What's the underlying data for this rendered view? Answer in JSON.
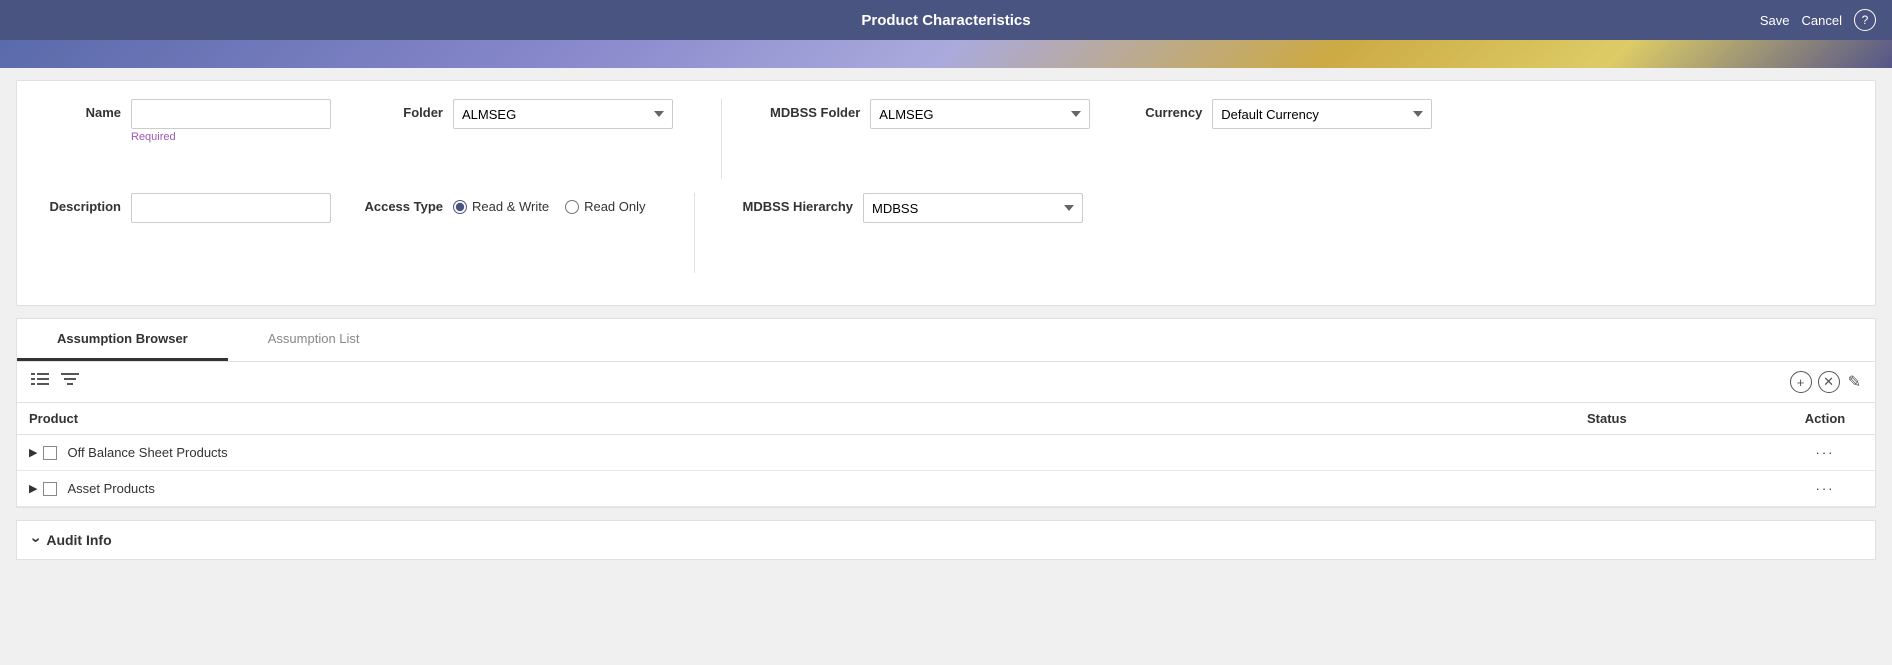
{
  "header": {
    "title": "Product Characteristics",
    "save_label": "Save",
    "cancel_label": "Cancel",
    "help_icon": "?"
  },
  "form": {
    "name_label": "Name",
    "name_placeholder": "",
    "name_required": "Required",
    "description_label": "Description",
    "description_placeholder": "",
    "folder_label": "Folder",
    "folder_value": "ALMSEG",
    "folder_options": [
      "ALMSEG"
    ],
    "access_type_label": "Access Type",
    "access_read_write": "Read & Write",
    "access_read_only": "Read Only",
    "mdbss_folder_label": "MDBSS Folder",
    "mdbss_folder_value": "ALMSEG",
    "mdbss_folder_options": [
      "ALMSEG"
    ],
    "currency_label": "Currency",
    "currency_value": "Default Currency",
    "currency_options": [
      "Default Currency"
    ],
    "mdbss_hierarchy_label": "MDBSS Hierarchy",
    "mdbss_hierarchy_value": "MDBSS",
    "mdbss_hierarchy_options": [
      "MDBSS"
    ]
  },
  "tabs": [
    {
      "id": "assumption-browser",
      "label": "Assumption Browser",
      "active": true
    },
    {
      "id": "assumption-list",
      "label": "Assumption List",
      "active": false
    }
  ],
  "table": {
    "columns": [
      {
        "id": "product",
        "label": "Product"
      },
      {
        "id": "status",
        "label": "Status"
      },
      {
        "id": "action",
        "label": "Action"
      }
    ],
    "rows": [
      {
        "product": "Off Balance Sheet Products",
        "status": "",
        "action": "···"
      },
      {
        "product": "Asset Products",
        "status": "",
        "action": "···"
      }
    ]
  },
  "audit": {
    "label": "Audit Info",
    "expand_icon": "›"
  },
  "toolbar": {
    "list_icon": "☰",
    "filter_icon": "⚙",
    "add_icon": "+",
    "remove_icon": "✕",
    "edit_icon": "✎"
  }
}
